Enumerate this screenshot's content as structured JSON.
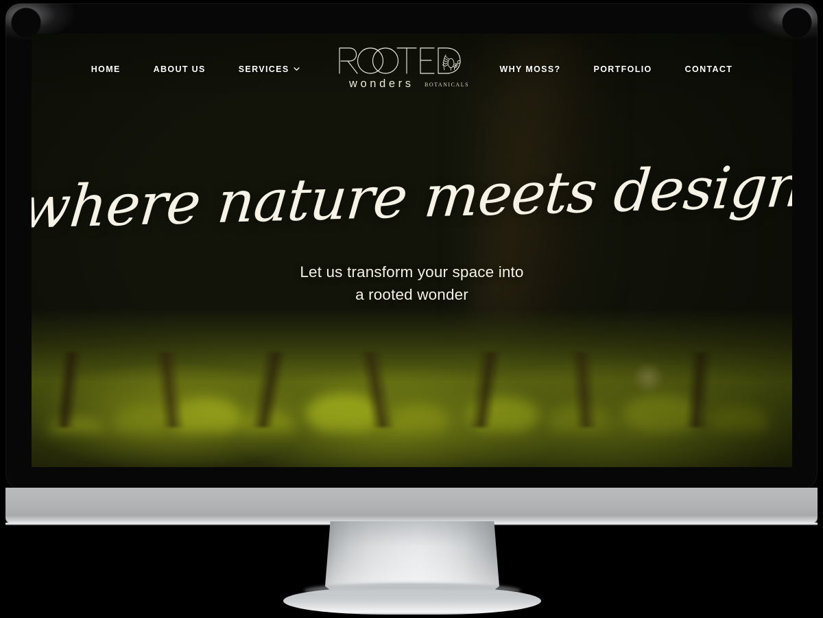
{
  "device": {
    "type": "desktop-monitor-mockup",
    "frame_color": "#070707",
    "chin_color": "#b2b4b6",
    "stand_color": "#dfe1e3"
  },
  "site": {
    "brand": {
      "name_primary": "ROOTED",
      "name_secondary": "wonders",
      "name_tertiary": "BOTANICALS",
      "mark": "fern-in-letter-d",
      "color": "#ece9dc"
    },
    "nav": {
      "left_items": [
        {
          "label": "HOME",
          "id": "home",
          "has_dropdown": false
        },
        {
          "label": "ABOUT US",
          "id": "about-us",
          "has_dropdown": false
        },
        {
          "label": "SERVICES",
          "id": "services",
          "has_dropdown": true
        }
      ],
      "right_items": [
        {
          "label": "WHY MOSS?",
          "id": "why-moss",
          "has_dropdown": false
        },
        {
          "label": "PORTFOLIO",
          "id": "portfolio",
          "has_dropdown": false
        },
        {
          "label": "CONTACT",
          "id": "contact",
          "has_dropdown": false
        }
      ],
      "dropdown_icon": "chevron-down-icon",
      "text_color": "#ffffff"
    },
    "hero": {
      "headline": "where nature meets design",
      "subheadline_line1": "Let us transform your space into",
      "subheadline_line2": "a rooted wonder",
      "text_color": "#f6f3e6",
      "background": {
        "subject": "close-up blurred green forest moss with twigs",
        "dominant_colors": [
          "#8d9411",
          "#5c6611",
          "#2e2d10",
          "#120f05"
        ],
        "accent_green": "#a3be24"
      }
    }
  }
}
